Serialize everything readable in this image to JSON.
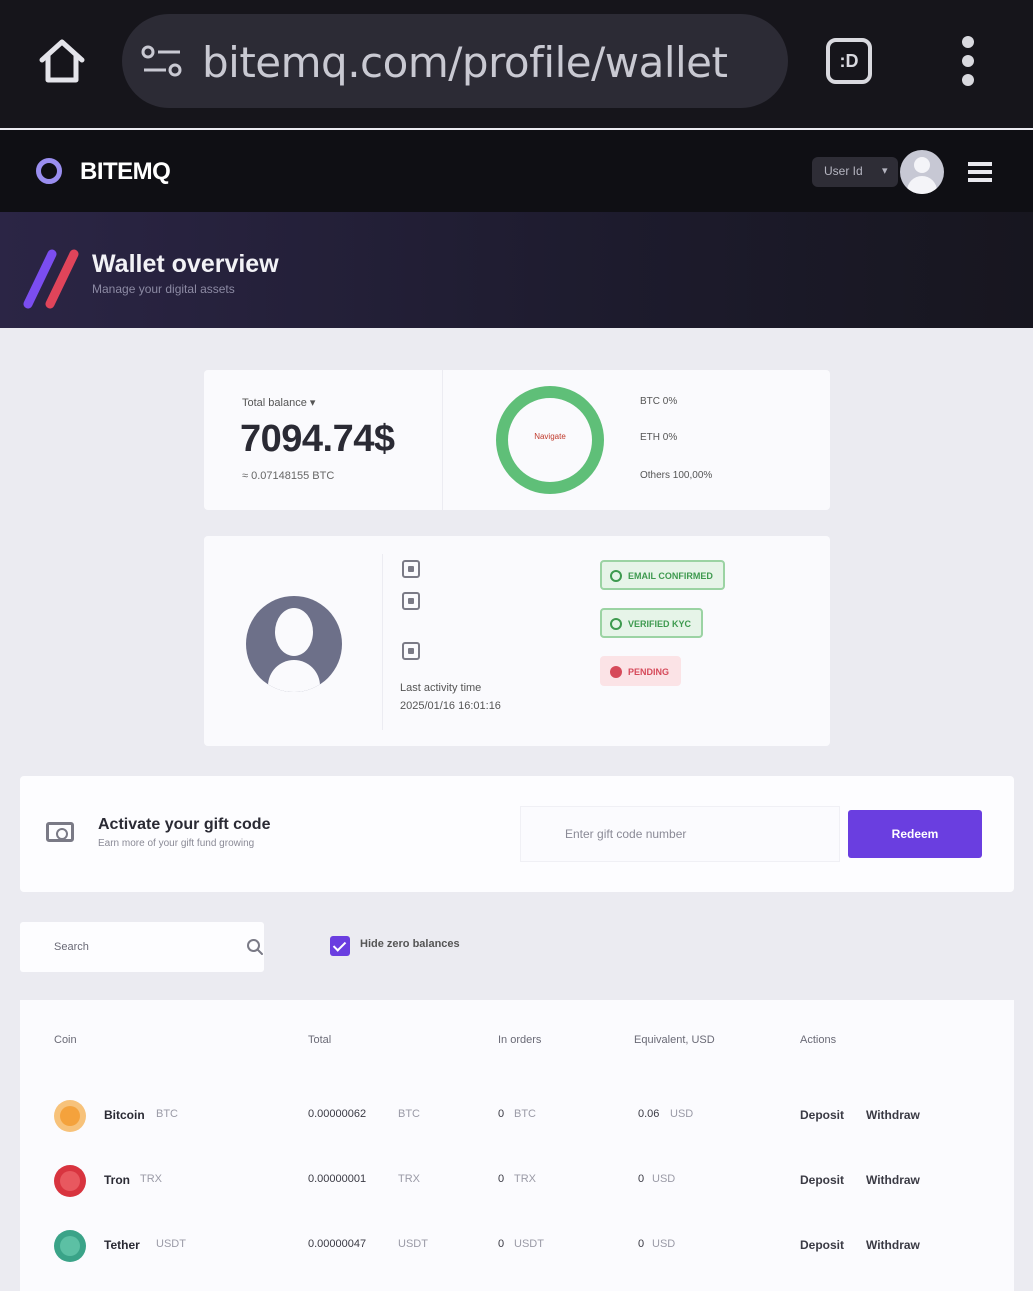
{
  "browser": {
    "url": "bitemq.com/profile/wallet",
    "tab_count": ":D"
  },
  "header": {
    "brand": "BITEMQ",
    "user_label": "User Id",
    "user_caret": "▾"
  },
  "banner": {
    "title": "Wallet overview",
    "subtitle": "Manage your digital assets"
  },
  "balance": {
    "label": "Total balance ▾",
    "amount": "7094.74$",
    "btc_equivalent": "≈ 0.07148155 BTC",
    "donut_center": "Navigate",
    "legend": [
      "BTC 0%",
      "ETH 0%",
      "Others 100,00%"
    ],
    "donut_color": "#5fbf78"
  },
  "profile": {
    "last_activity_label": "Last activity time",
    "last_activity_time": "2025/01/16 16:01:16",
    "badges": [
      {
        "label": "EMAIL CONFIRMED",
        "status": "ok"
      },
      {
        "label": "VERIFIED KYC",
        "status": "ok"
      },
      {
        "label": "PENDING",
        "status": "error"
      }
    ]
  },
  "gift": {
    "title": "Activate your gift code",
    "subtitle": "Earn more of your gift fund growing",
    "input_placeholder": "Enter gift code number",
    "button_label": "Redeem"
  },
  "filters": {
    "search_placeholder": "Search",
    "hide_zero_label": "Hide zero balances",
    "hide_zero_checked": true
  },
  "table": {
    "headers": [
      "Coin",
      "Total",
      "In orders",
      "Equivalent, USD",
      "Actions"
    ],
    "rows": [
      {
        "name": "Bitcoin",
        "ticker": "BTC",
        "total": "0.00000062",
        "total_unit": "BTC",
        "in_orders": "0",
        "in_orders_unit": "BTC",
        "equivalent": "0.06",
        "equivalent_unit": "USD",
        "actions": [
          "Deposit",
          "Withdraw"
        ],
        "icon": "bitcoin-icon",
        "color": "#f4a23c"
      },
      {
        "name": "Tron",
        "ticker": "TRX",
        "total": "0.00000001",
        "total_unit": "TRX",
        "in_orders": "0",
        "in_orders_unit": "TRX",
        "equivalent": "0",
        "equivalent_unit": "USD",
        "actions": [
          "Deposit",
          "Withdraw"
        ],
        "icon": "tron-icon",
        "color": "#d8343f"
      },
      {
        "name": "Tether",
        "ticker": "USDT",
        "total": "0.00000047",
        "total_unit": "USDT",
        "in_orders": "0",
        "in_orders_unit": "USDT",
        "equivalent": "0",
        "equivalent_unit": "USD",
        "actions": [
          "Deposit",
          "Withdraw"
        ],
        "icon": "tether-icon",
        "color": "#3aa388"
      }
    ]
  },
  "colors": {
    "accent": "#6a3ee0",
    "brand_ring": "#9a8ef0",
    "success": "#3e9a4f",
    "danger": "#d64a5a"
  }
}
